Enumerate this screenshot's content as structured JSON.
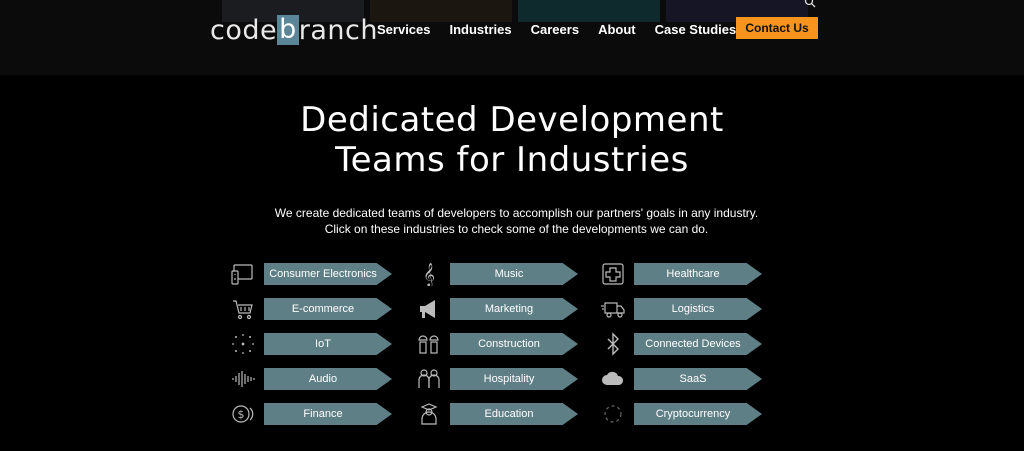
{
  "header": {
    "logo": {
      "left": "code",
      "box": "b",
      "right": "ranch"
    },
    "nav": [
      "Services",
      "Industries",
      "Careers",
      "About",
      "Case Studies"
    ],
    "contact_label": "Contact Us"
  },
  "hero": {
    "title_line1": "Dedicated Development",
    "title_line2": "Teams for Industries",
    "subtitle_line1": "We create dedicated teams of developers to accomplish our partners' goals in any industry.",
    "subtitle_line2": "Click on these industries to check some of the developments we can do."
  },
  "industries": {
    "col1": [
      {
        "label": "Consumer Electronics",
        "icon": "tv-remote-icon"
      },
      {
        "label": "E-commerce",
        "icon": "shopping-cart-icon"
      },
      {
        "label": "IoT",
        "icon": "network-dots-icon"
      },
      {
        "label": "Audio",
        "icon": "sound-wave-icon"
      },
      {
        "label": "Finance",
        "icon": "coins-icon"
      }
    ],
    "col2": [
      {
        "label": "Music",
        "icon": "treble-clef-icon"
      },
      {
        "label": "Marketing",
        "icon": "megaphone-icon"
      },
      {
        "label": "Construction",
        "icon": "workers-icon"
      },
      {
        "label": "Hospitality",
        "icon": "people-icon"
      },
      {
        "label": "Education",
        "icon": "teacher-icon"
      }
    ],
    "col3": [
      {
        "label": "Healthcare",
        "icon": "medical-cross-icon"
      },
      {
        "label": "Logistics",
        "icon": "truck-icon"
      },
      {
        "label": "Connected Devices",
        "icon": "bluetooth-icon"
      },
      {
        "label": "SaaS",
        "icon": "cloud-icon"
      },
      {
        "label": "Cryptocurrency",
        "icon": "crypto-icon"
      }
    ]
  },
  "colors": {
    "accent": "#f7941d",
    "tag": "#5f7f86",
    "logo_box": "#5b8697"
  }
}
